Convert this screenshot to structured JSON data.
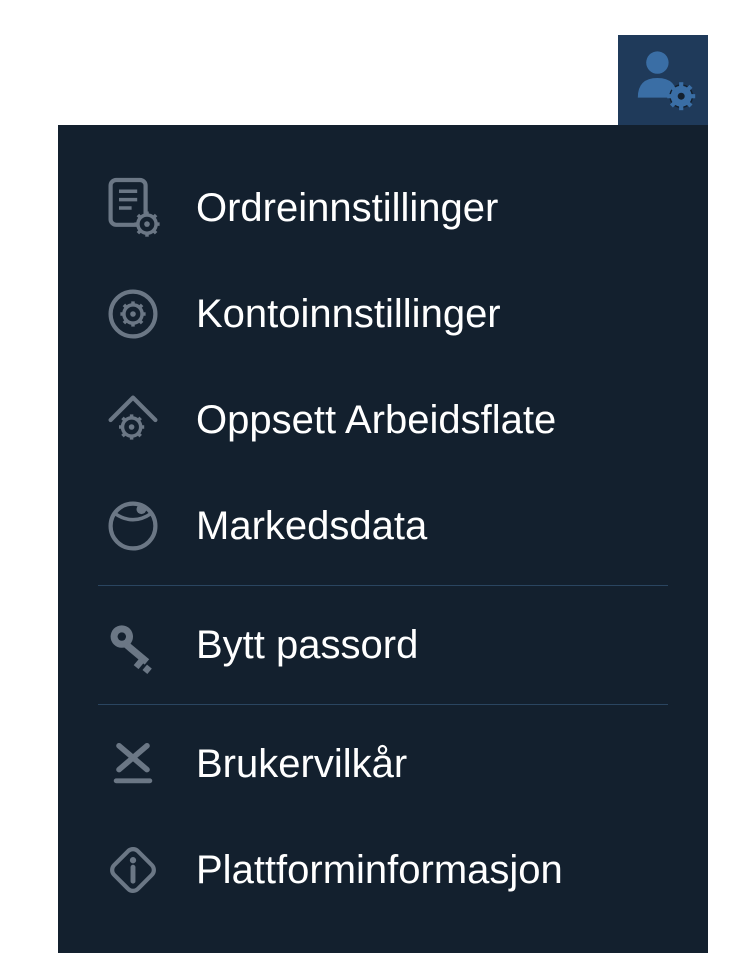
{
  "menu": {
    "items": [
      {
        "id": "order-settings",
        "label": "Ordreinnstillinger"
      },
      {
        "id": "account-settings",
        "label": "Kontoinnstillinger"
      },
      {
        "id": "workspace-setup",
        "label": "Oppsett Arbeidsflate"
      },
      {
        "id": "market-data",
        "label": "Markedsdata"
      },
      {
        "id": "change-password",
        "label": "Bytt passord"
      },
      {
        "id": "terms",
        "label": "Brukervilkår"
      },
      {
        "id": "platform-info",
        "label": "Plattforminformasjon"
      }
    ]
  },
  "colors": {
    "panelBg": "#13202e",
    "buttonBg": "#1f3a5a",
    "iconStroke": "#6b7785",
    "userIcon": "#3a6ea5",
    "divider": "#2a4560",
    "text": "#ffffff"
  }
}
